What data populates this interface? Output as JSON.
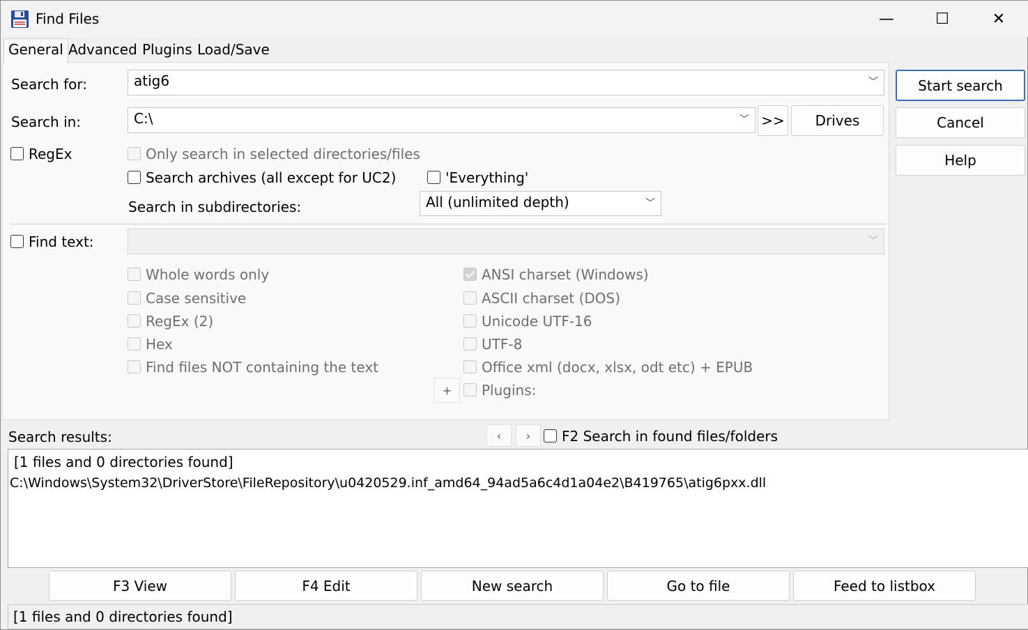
{
  "window": {
    "title": "Find Files",
    "minimize_glyph": "—",
    "maximize_glyph": "☐",
    "close_glyph": "✕"
  },
  "tabs": [
    {
      "label": "General",
      "active": true
    },
    {
      "label": "Advanced"
    },
    {
      "label": "Plugins"
    },
    {
      "label": "Load/Save"
    }
  ],
  "general": {
    "search_for_label": "Search for:",
    "search_for_value": "atig6",
    "search_in_label": "Search in:",
    "search_in_value": "C:\\",
    "browse_label": ">>",
    "drives_label": "Drives",
    "regex_label": "RegEx",
    "only_selected_label": "Only search in selected directories/files",
    "search_archives_label": "Search archives (all except for UC2)",
    "everything_label": "'Everything'",
    "subdirs_label": "Search in subdirectories:",
    "subdirs_value": "All (unlimited depth)",
    "find_text_label": "Find text:",
    "find_text_value": "",
    "options_left": [
      "Whole words only",
      "Case sensitive",
      "RegEx (2)",
      "Hex",
      "Find files NOT containing the text"
    ],
    "options_right": [
      "ANSI charset (Windows)",
      "ASCII charset (DOS)",
      "Unicode UTF-16",
      "UTF-8",
      "Office xml (docx, xlsx, odt etc) + EPUB",
      "Plugins:"
    ],
    "plus_label": "+"
  },
  "side_buttons": {
    "start": "Start search",
    "cancel": "Cancel",
    "help": "Help"
  },
  "results": {
    "label": "Search results:",
    "prev_glyph": "‹",
    "next_glyph": "›",
    "f2_label": "F2 Search in found files/folders",
    "lines": [
      "[1 files and 0 directories found]",
      "C:\\Windows\\System32\\DriverStore\\FileRepository\\u0420529.inf_amd64_94ad5a6c4d1a04e2\\B419765\\atig6pxx.dll"
    ]
  },
  "bottom_buttons": [
    "F3 View",
    "F4 Edit",
    "New search",
    "Go to file",
    "Feed to listbox"
  ],
  "status": "[1 files and 0 directories found]"
}
